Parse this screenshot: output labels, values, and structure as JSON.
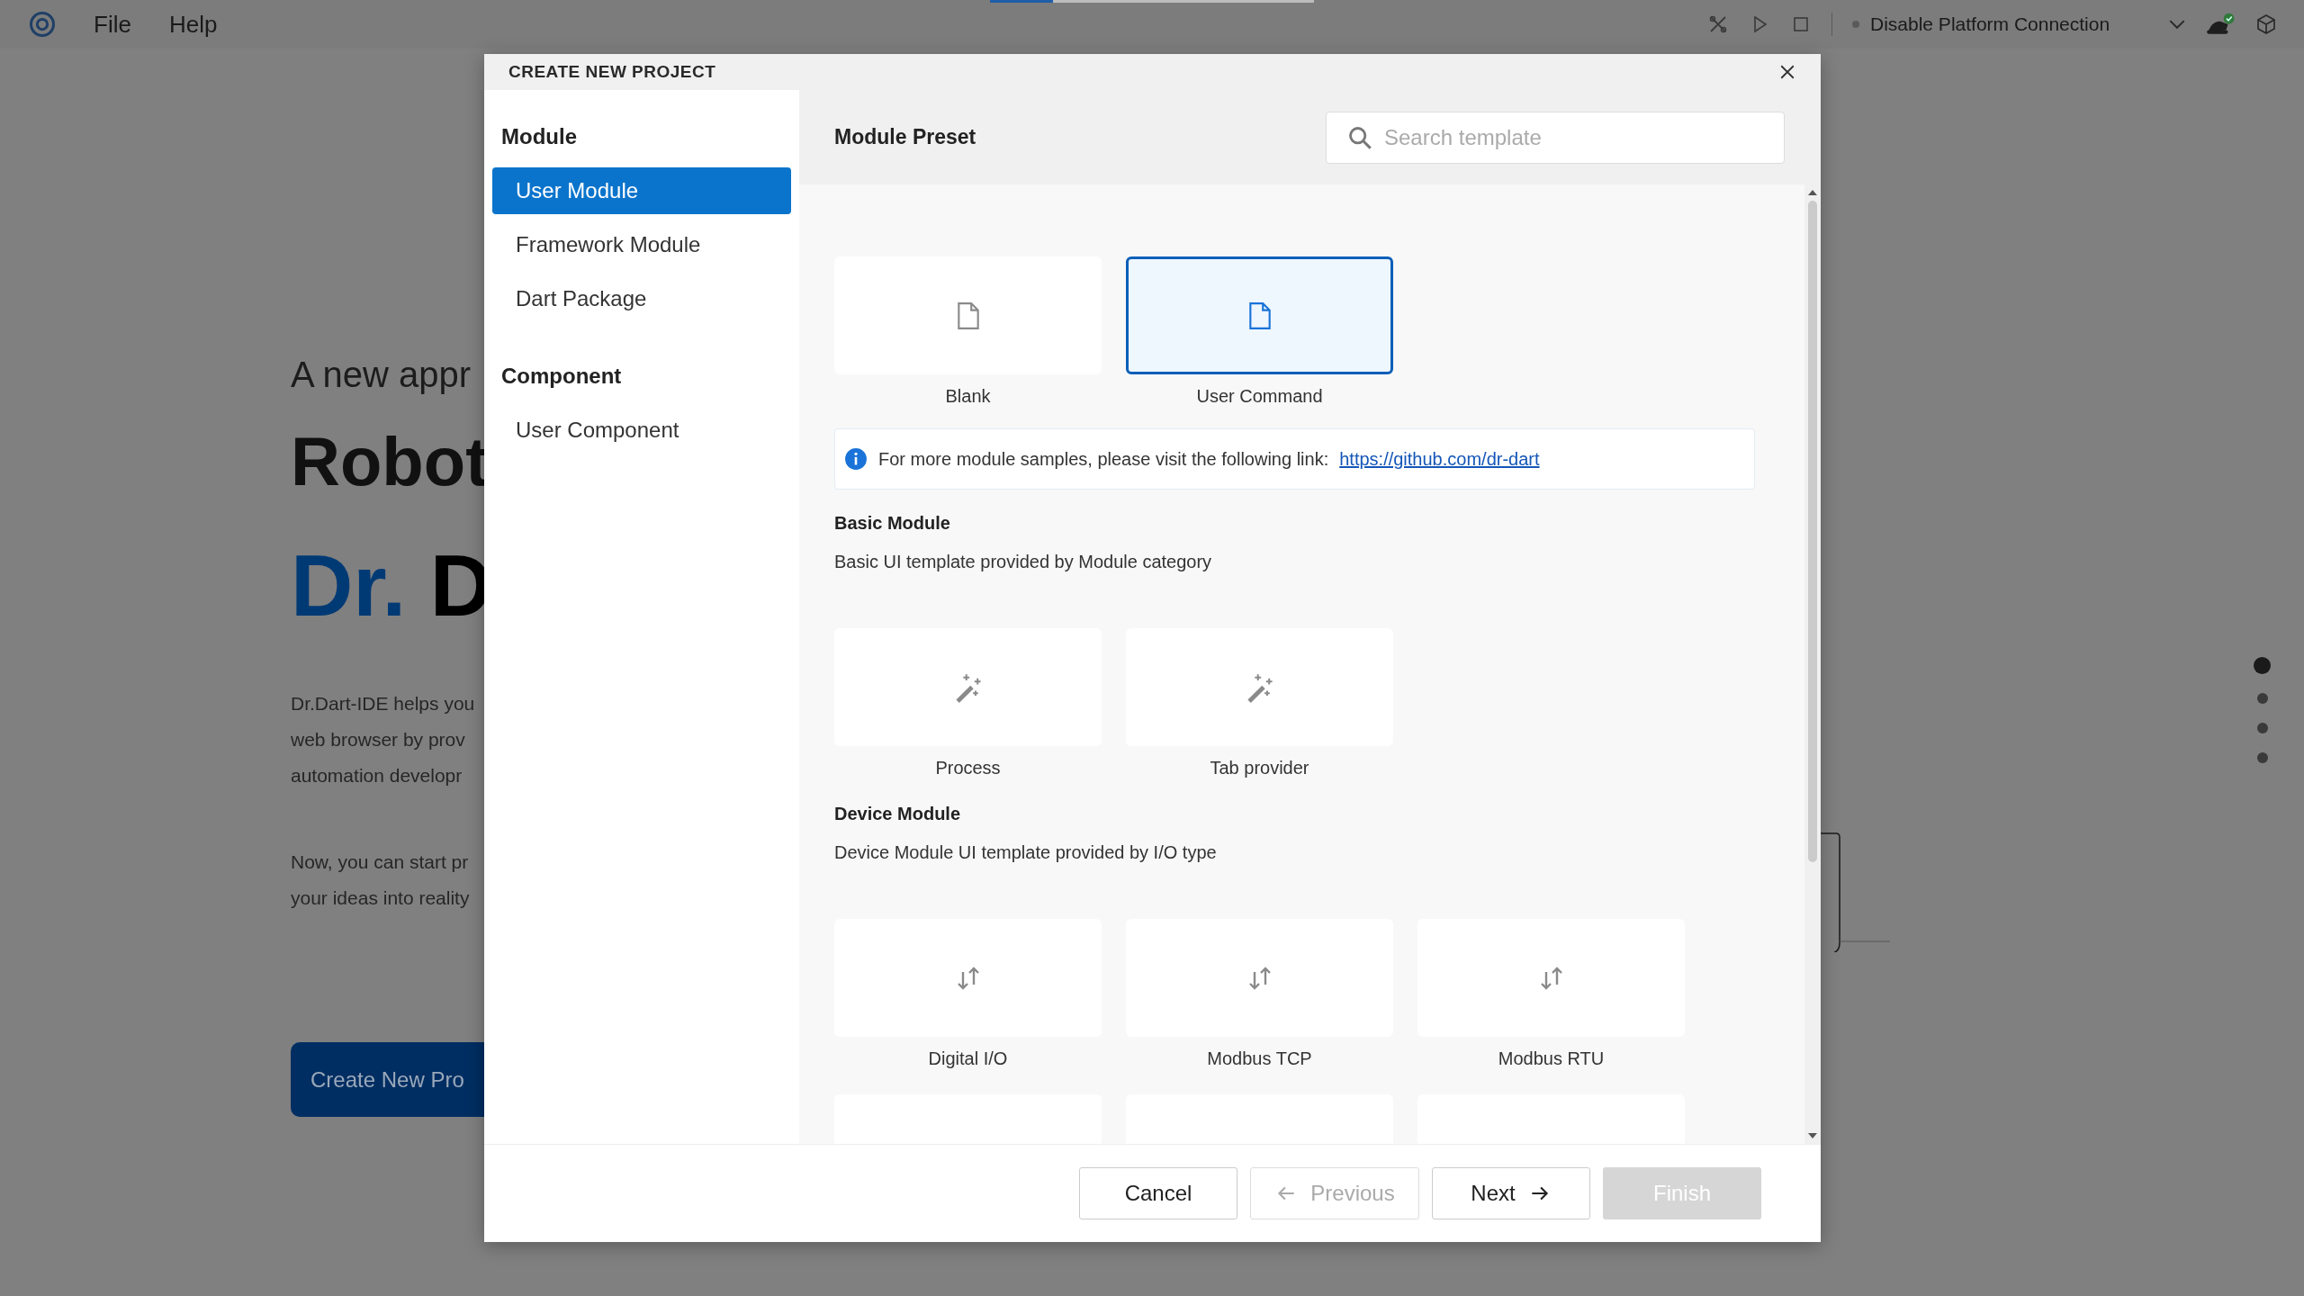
{
  "menu_bar": {
    "items": [
      "File",
      "Help"
    ]
  },
  "toolbar": {
    "connection": "Disable Platform Connection"
  },
  "home": {
    "tagline": "A new appr",
    "headline": "Robot",
    "brand_prefix": "Dr.",
    "brand_rest": "D",
    "paragraphs": [
      [
        "Dr.Dart-IDE helps you",
        "web browser by prov",
        "automation developr"
      ],
      [
        "Now, you can start pr",
        "your ideas into reality"
      ]
    ],
    "button": "Create New Pro"
  },
  "page_dots": [
    {
      "selected": true
    },
    {
      "selected": false
    },
    {
      "selected": false
    },
    {
      "selected": false
    }
  ],
  "dialog": {
    "title": "CREATE NEW PROJECT",
    "sidebar": {
      "groups": [
        {
          "heading": "Module",
          "items": [
            {
              "label": "User Module",
              "selected": true
            },
            {
              "label": "Framework Module",
              "selected": false
            },
            {
              "label": "Dart Package",
              "selected": false
            }
          ]
        },
        {
          "heading": "Component",
          "items": [
            {
              "label": "User Component",
              "selected": false
            }
          ]
        }
      ]
    },
    "header": "Module Preset",
    "search": {
      "placeholder": "Search template"
    },
    "presets": [
      {
        "label": "Blank",
        "kind": "file",
        "selected": false
      },
      {
        "label": "User Command",
        "kind": "file",
        "selected": true
      }
    ],
    "info": {
      "text": "For more module samples, please visit the following link:",
      "link": "https://github.com/dr-dart"
    },
    "sections": [
      {
        "title": "Basic Module",
        "description": "Basic UI template provided by Module category",
        "templates": [
          {
            "label": "Process",
            "kind": "wand"
          },
          {
            "label": "Tab provider",
            "kind": "wand"
          }
        ]
      },
      {
        "title": "Device Module",
        "description": "Device Module UI template provided by I/O type",
        "templates": [
          {
            "label": "Digital I/O",
            "kind": "arrows"
          },
          {
            "label": "Modbus TCP",
            "kind": "arrows"
          },
          {
            "label": "Modbus RTU",
            "kind": "arrows"
          },
          {
            "kind": "cut"
          },
          {
            "kind": "cut"
          },
          {
            "kind": "cut"
          }
        ]
      }
    ],
    "buttons": [
      {
        "label": "Cancel",
        "kind": "plain",
        "disabled": false
      },
      {
        "label": "Previous",
        "kind": "back",
        "disabled": true
      },
      {
        "label": "Next",
        "kind": "forward",
        "disabled": false
      },
      {
        "label": "Finish",
        "kind": "primary",
        "disabled": true
      }
    ]
  }
}
